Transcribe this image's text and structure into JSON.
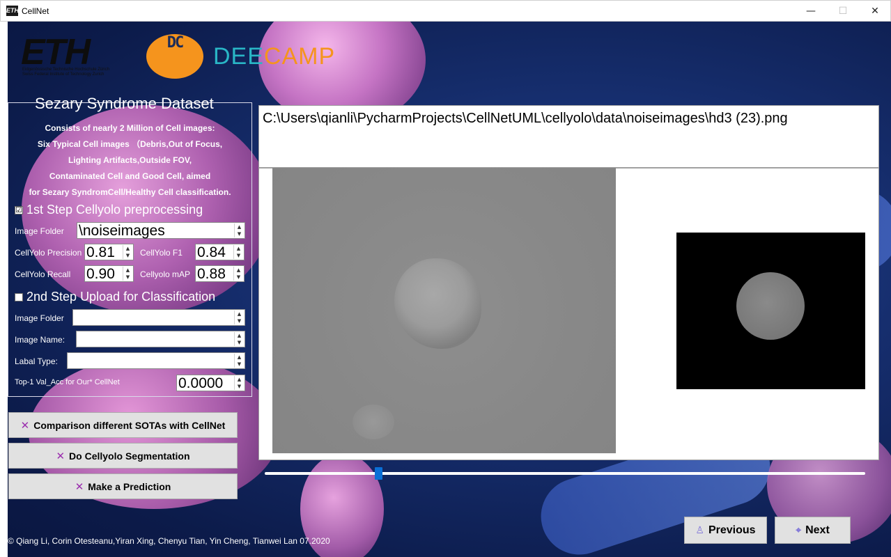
{
  "window": {
    "title": "CellNet",
    "icon_text": "ETH",
    "min": "—",
    "max": "☐",
    "close": "✕"
  },
  "logos": {
    "eth_word": "ETH",
    "eth_sub": "Eidgenössische Technische Hochschule Zürich\nSwiss Federal Institute of Technology Zurich",
    "dc_glyph": "DC",
    "deecamp_dee": "DEE",
    "deecamp_camp": "CAMP"
  },
  "dataset": {
    "title": "Sezary Syndrome Dataset",
    "description": [
      "Consists of nearly 2 Million of Cell images:",
      "Six  Typical  Cell  images （Debris,Out of Focus,",
      "Lighting Artifacts,Outside FOV,",
      "Contaminated Cell  and Good Cell, aimed",
      "for Sezary SyndromCell/Healthy  Cell  classification."
    ]
  },
  "step1": {
    "label": "1st Step Cellyolo preprocessing",
    "checked": "☑",
    "image_folder_label": "Image Folder",
    "image_folder_value": "\\noiseimages",
    "precision_label": "CellYolo Precision",
    "precision_value": "0.81",
    "f1_label": "CellYolo F1",
    "f1_value": "0.84",
    "recall_label": "CellYolo Recall",
    "recall_value": "0.90",
    "map_label": "Cellyolo mAP",
    "map_value": "0.88"
  },
  "step2": {
    "label": "2nd Step Upload for Classification",
    "checked": "",
    "image_folder_label": "Image Folder",
    "image_folder_value": "",
    "image_name_label": "Image Name:",
    "image_name_value": "",
    "label_type_label": "Labal Type:",
    "label_type_value": "",
    "top1_label": "Top-1 Val_Acc for Our* CellNet",
    "top1_value": "0.0000"
  },
  "buttons": {
    "compare": "Comparison different SOTAs with CellNet",
    "segment": "Do Cellyolo Segmentation",
    "predict": "Make a Prediction",
    "x_mark": "✕",
    "previous": "Previous",
    "next": "Next"
  },
  "viewer": {
    "path": "C:\\Users\\qianli\\PycharmProjects\\CellNetUML\\cellyolo\\data\\noiseimages\\hd3 (23).png",
    "slider_position": 0.19
  },
  "footer": {
    "copyright": "© Qiang Li, Corin Otesteanu,Yiran Xing, Chenyu Tian, Yin Cheng, Tianwei Lan 07.2020"
  },
  "colors": {
    "accent": "#0a6fd6",
    "x_mark": "#9b2fae",
    "orange": "#f5941d",
    "teal": "#29b6c6"
  }
}
